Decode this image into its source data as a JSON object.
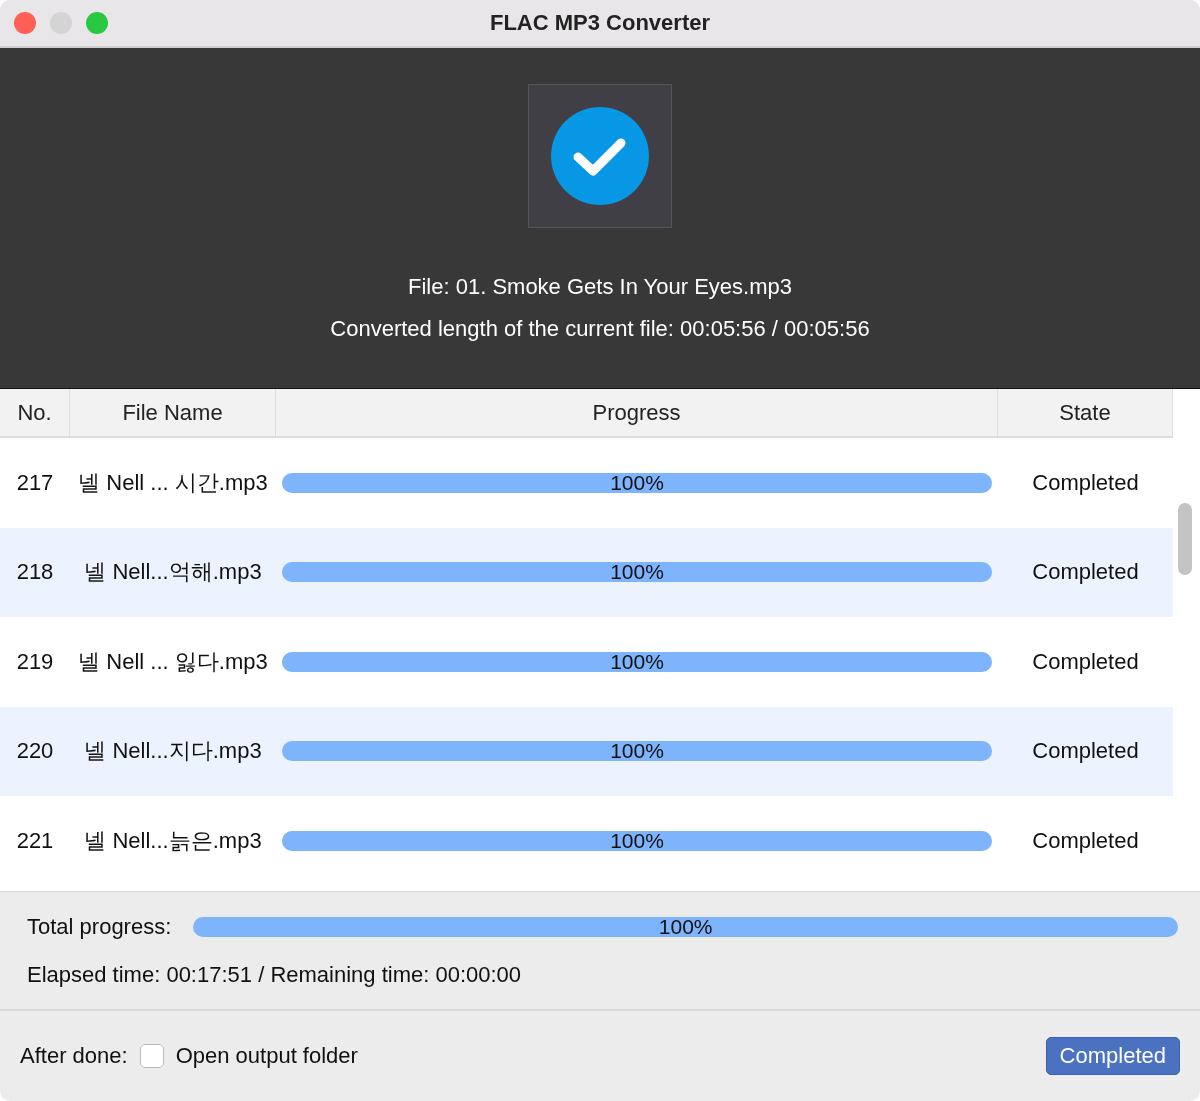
{
  "window": {
    "title": "FLAC MP3 Converter"
  },
  "current": {
    "file": "File: 01. Smoke Gets In Your Eyes.mp3",
    "length": "Converted length of the current file: 00:05:56 / 00:05:56"
  },
  "table": {
    "columns": [
      "No.",
      "File Name",
      "Progress",
      "State"
    ],
    "rows": [
      {
        "no": "217",
        "file": "넬 Nell ... 시간.mp3",
        "level": 1,
        "progress": "100%",
        "state": "Completed"
      },
      {
        "no": "218",
        "file": "넬 Nell...억해.mp3",
        "level": 1,
        "progress": "100%",
        "state": "Completed"
      },
      {
        "no": "219",
        "file": "넬 Nell ... 잃다.mp3",
        "level": 1,
        "progress": "100%",
        "state": "Completed"
      },
      {
        "no": "220",
        "file": "넬 Nell...지다.mp3",
        "level": 1,
        "progress": "100%",
        "state": "Completed"
      },
      {
        "no": "221",
        "file": "넬 Nell...늙은.mp3",
        "level": 1,
        "progress": "100%",
        "state": "Completed"
      }
    ]
  },
  "total": {
    "label": "Total progress:",
    "level": 1,
    "progress": "100%",
    "times": "Elapsed time: 00:17:51 / Remaining time: 00:00:00"
  },
  "footer": {
    "label": "After done:",
    "open_folder": {
      "label": "Open output folder",
      "checked": false
    },
    "button": "Completed"
  }
}
